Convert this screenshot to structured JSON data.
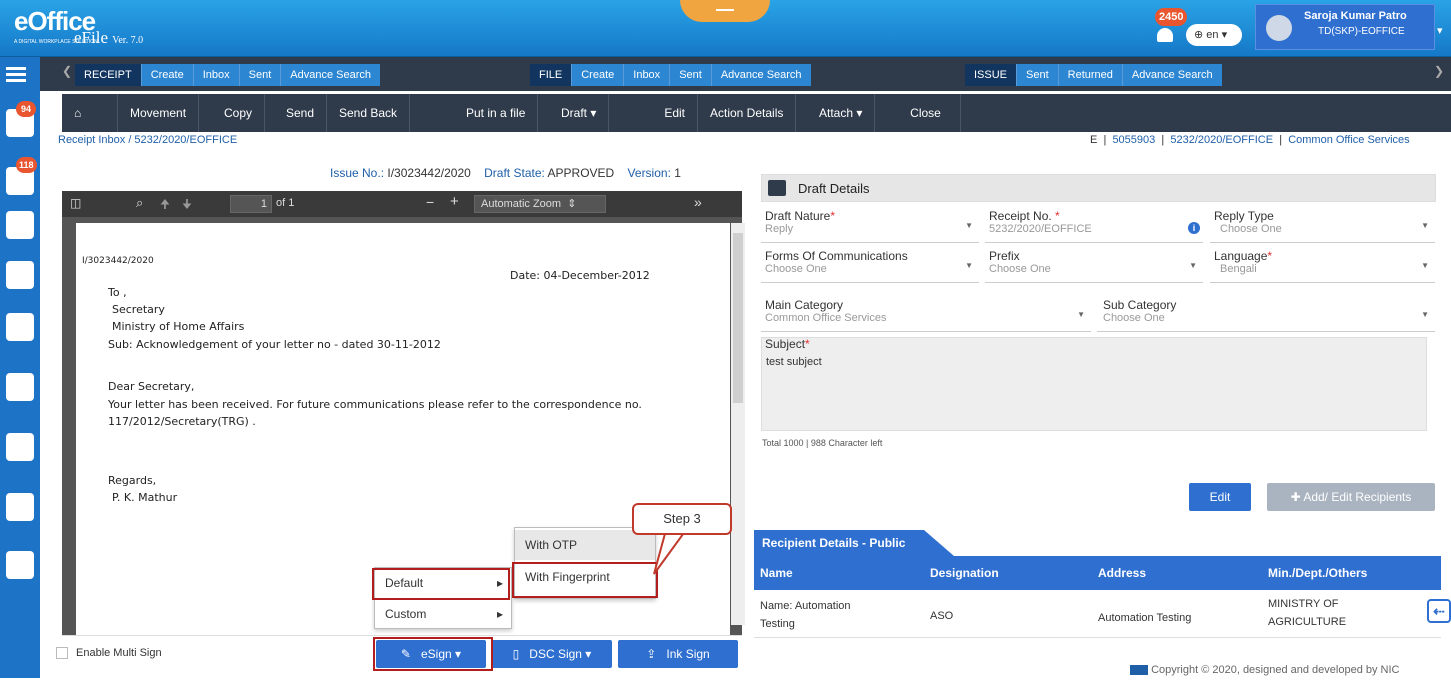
{
  "header": {
    "logo_main": "eOffice",
    "logo_tagline": "A DIGITAL WORKPLACE SOLUTION",
    "app_name": "eFile",
    "version": "Ver. 7.0",
    "notification_count": "2450",
    "language": "en",
    "user_name": "Saroja Kumar Patro",
    "user_dept": "TD(SKP)-EOFFICE"
  },
  "rail": {
    "receipt_badge": "94",
    "file_badge": "118"
  },
  "menubar": {
    "receipt": {
      "title": "RECEIPT",
      "items": [
        "Create",
        "Inbox",
        "Sent",
        "Advance Search"
      ]
    },
    "file": {
      "title": "FILE",
      "items": [
        "Create",
        "Inbox",
        "Sent",
        "Advance Search"
      ]
    },
    "issue": {
      "title": "ISSUE",
      "items": [
        "Sent",
        "Returned",
        "Advance Search"
      ]
    }
  },
  "toolbar": {
    "items": [
      "Movement",
      "Copy",
      "Send",
      "Send Back",
      "Put in a file",
      "Draft",
      "Edit",
      "Action Details",
      "Attach",
      "Close"
    ]
  },
  "breadcrumb": {
    "path": "Receipt Inbox / 5232/2020/EOFFICE",
    "right_e": "E",
    "right_num": "5055903",
    "right_file": "5232/2020/EOFFICE",
    "right_cat": "Common Office Services"
  },
  "docinfo": {
    "issue_label": "Issue No.:",
    "issue_no": "I/3023442/2020",
    "state_label": "Draft State:",
    "state": "APPROVED",
    "version_label": "Version:",
    "version": "1"
  },
  "pdf": {
    "page_input": "1",
    "page_total": "of 1",
    "zoom": "Automatic Zoom"
  },
  "letter": {
    "ref": "I/3023442/2020",
    "date": "Date: 04-December-2012",
    "to": "To ,",
    "l1": "Secretary",
    "l2": "Ministry of Home Affairs",
    "sub": "Sub: Acknowledgement of your letter no - dated 30-11-2012",
    "dear": "Dear Secretary,",
    "body1": "Your letter has been received. For future communications please refer to the correspondence no.",
    "body2": "117/2012/Secretary(TRG) .",
    "regards": "Regards,",
    "sign": "P. K. Mathur"
  },
  "sign_menu": {
    "default": "Default",
    "custom": "Custom",
    "otp": "With OTP",
    "fingerprint": "With Fingerprint",
    "step": "Step 3"
  },
  "doc_footer": {
    "multi_sign": "Enable Multi Sign",
    "esign": "eSign",
    "dsc": "DSC Sign",
    "ink": "Ink Sign"
  },
  "draft": {
    "title": "Draft Details",
    "nature_label": "Draft Nature",
    "nature_value": "Reply",
    "receipt_label": "Receipt No.",
    "receipt_value": "5232/2020/EOFFICE",
    "reply_label": "Reply Type",
    "reply_value": "Choose One",
    "forms_label": "Forms Of Communications",
    "forms_value": "Choose One",
    "prefix_label": "Prefix",
    "prefix_value": "Choose One",
    "lang_label": "Language",
    "lang_value": "Bengali",
    "main_label": "Main Category",
    "main_value": "Common Office Services",
    "sub_label": "Sub Category",
    "sub_value": "Choose One",
    "subject_label": "Subject",
    "subject_value": "test subject",
    "char_count": "Total 1000 | 988 Character left",
    "edit": "Edit",
    "add_edit": "Add/ Edit Recipients"
  },
  "recipients": {
    "tab": "Recipient Details - Public",
    "cols": [
      "Name",
      "Designation",
      "Address",
      "Min./Dept./Others"
    ],
    "row": {
      "name1": "Name: Automation",
      "name2": "Testing",
      "designation": "ASO",
      "address": "Automation Testing",
      "min1": "MINISTRY OF",
      "min2": "AGRICULTURE"
    }
  },
  "footer": {
    "copyright": "Copyright © 2020, designed and developed by NIC"
  },
  "colors": {
    "header_blue": "#1f86d6",
    "nav_dark": "#2f3a4a",
    "accent_blue": "#2e6fd0",
    "annotation_red": "#b21e1e"
  }
}
